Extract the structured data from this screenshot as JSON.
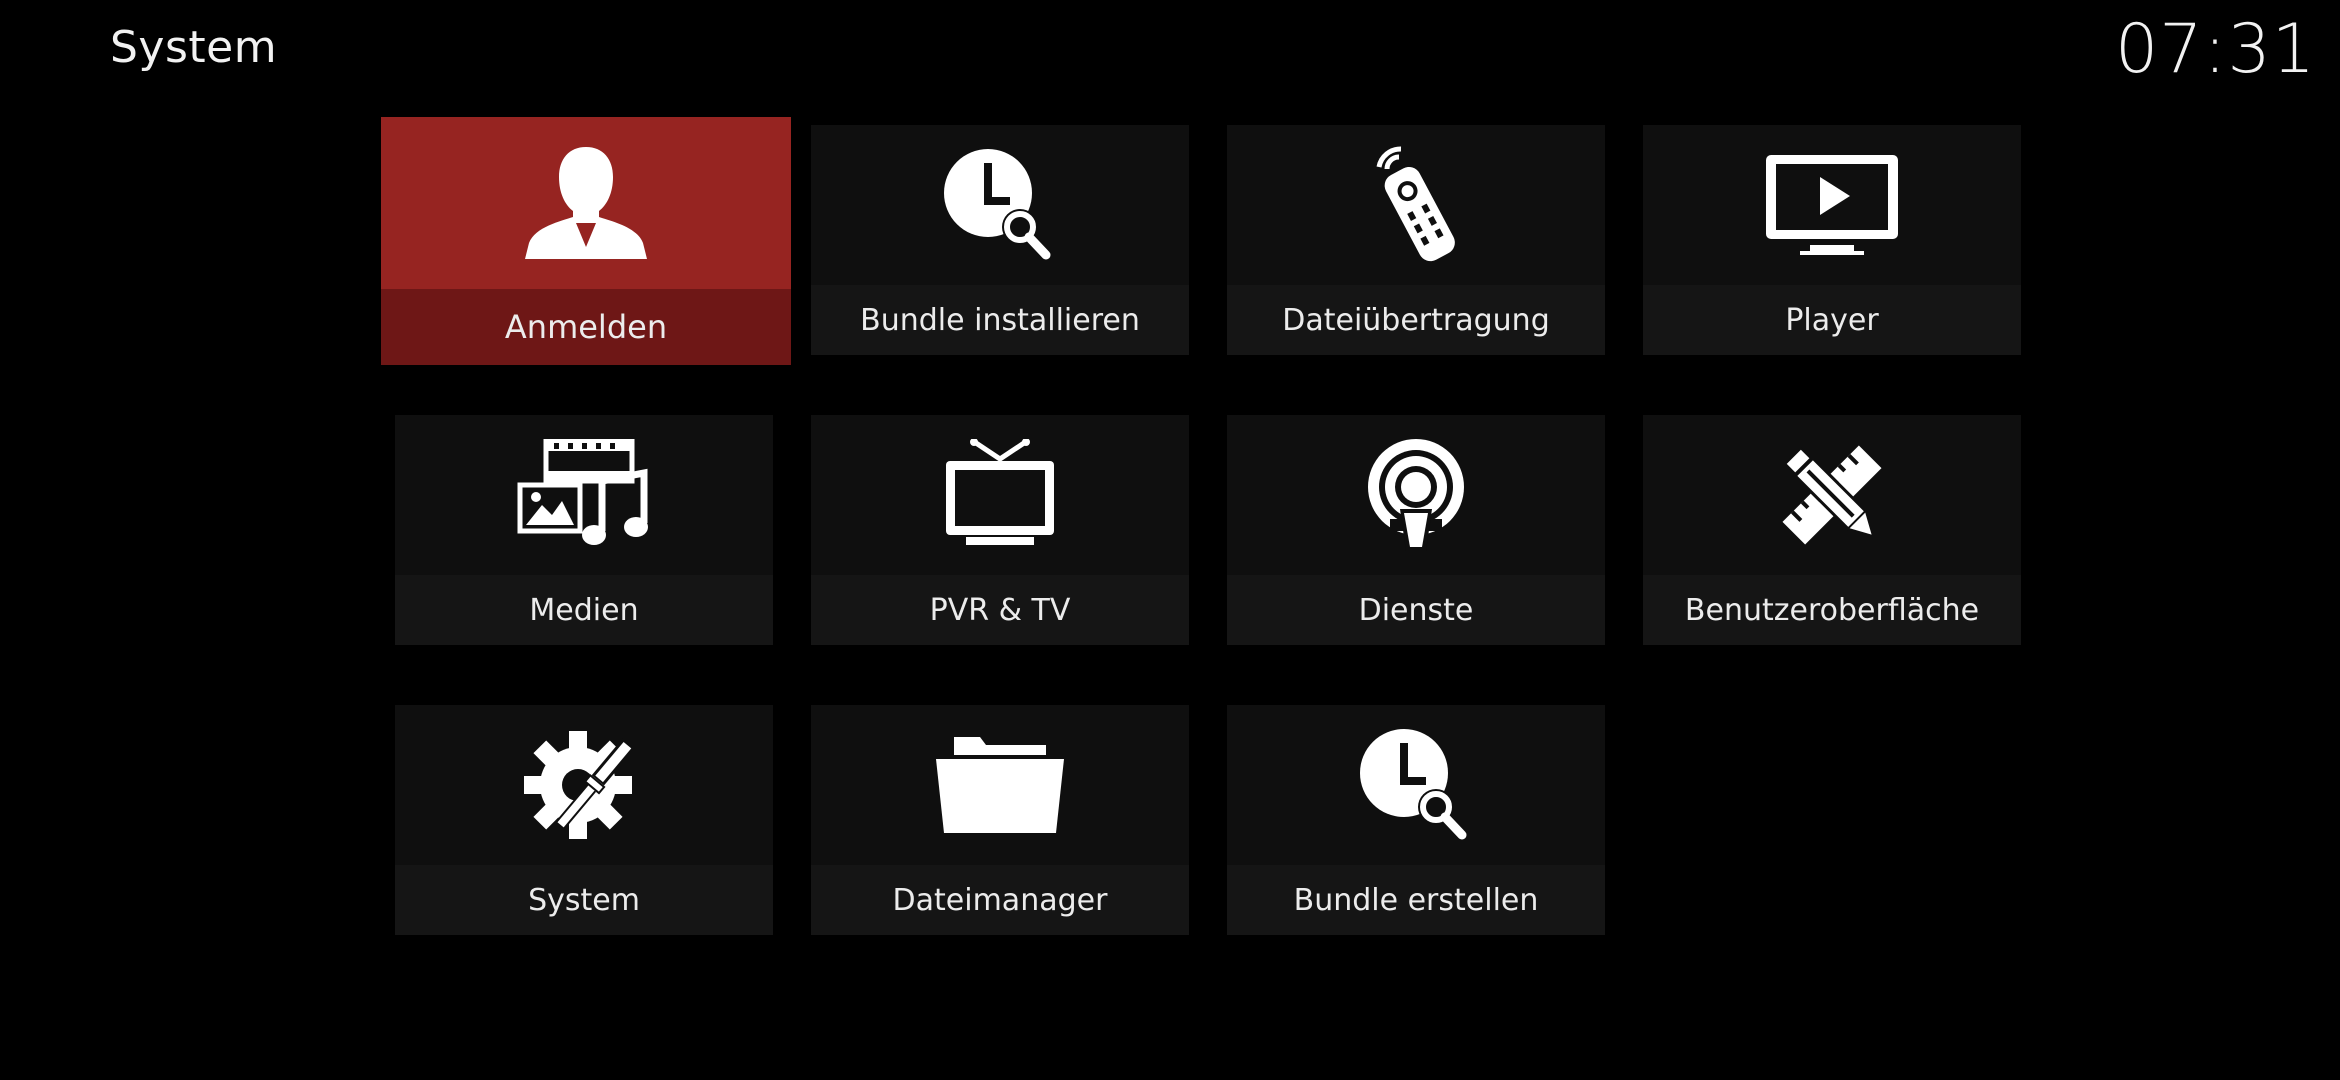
{
  "header": {
    "title": "System",
    "clock": "07:31"
  },
  "colors": {
    "background": "#000000",
    "tile": "#0f0f0f",
    "tile_label_bar": "#151515",
    "focus": "#962421",
    "focus_label_bar": "#6e1716"
  },
  "tiles": [
    {
      "label": "Anmelden",
      "icon": "user-profile-icon",
      "focused": true
    },
    {
      "label": "Bundle installieren",
      "icon": "clock-search-icon"
    },
    {
      "label": "Dateiübertragung",
      "icon": "remote-control-icon"
    },
    {
      "label": "Player",
      "icon": "monitor-play-icon"
    },
    {
      "label": "Medien",
      "icon": "media-library-icon"
    },
    {
      "label": "PVR & TV",
      "icon": "tv-antenna-icon"
    },
    {
      "label": "Dienste",
      "icon": "podcast-broadcast-icon"
    },
    {
      "label": "Benutzeroberfläche",
      "icon": "pencil-ruler-icon"
    },
    {
      "label": "System",
      "icon": "gear-screwdriver-icon"
    },
    {
      "label": "Dateimanager",
      "icon": "folder-icon"
    },
    {
      "label": "Bundle erstellen",
      "icon": "clock-search-icon"
    }
  ]
}
